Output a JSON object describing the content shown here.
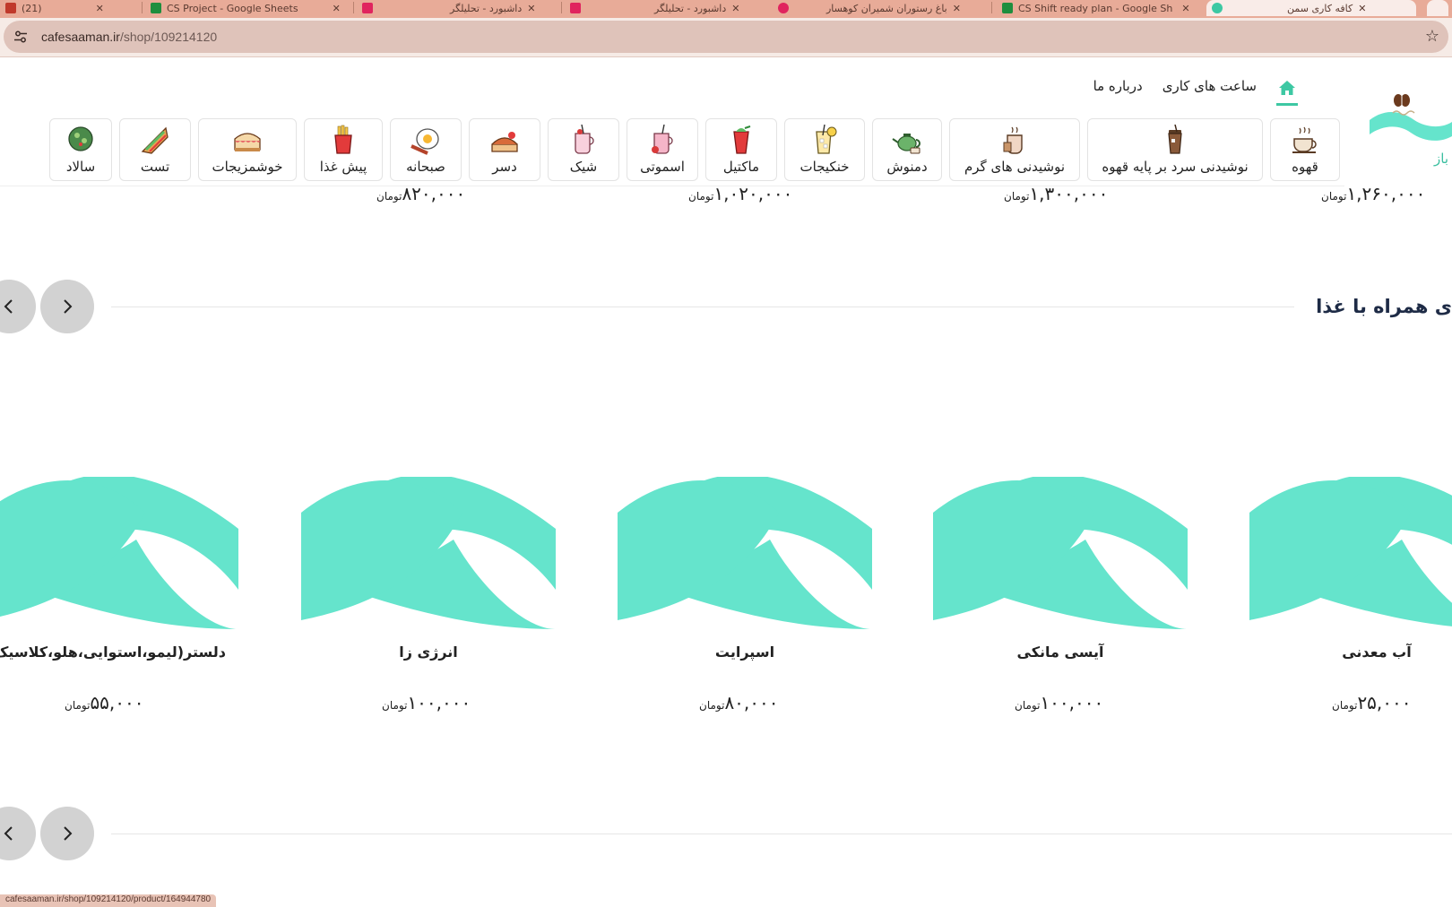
{
  "browser": {
    "tabs": [
      {
        "label": "(21)",
        "favicon_color": "#c0392b"
      },
      {
        "label": "CS Project - Google Sheets",
        "favicon_color": "#1e8e3e"
      },
      {
        "label": "داشبورد - تحلیلگر",
        "favicon_color": "#e0245e"
      },
      {
        "label": "داشبورد - تحلیلگر",
        "favicon_color": "#e0245e"
      },
      {
        "label": "باغ رستوران شمیران کوهسار",
        "favicon_color": "#e0245e"
      },
      {
        "label": "CS Shift ready plan - Google Sh",
        "favicon_color": "#1e8e3e"
      },
      {
        "label": "کافه کاری سمن",
        "favicon_color": "#3dc8a3"
      }
    ],
    "url_host": "cafesaaman.ir",
    "url_path": "/shop/109214120",
    "status_url": "cafesaaman.ir/shop/109214120/product/164944780"
  },
  "header": {
    "logo_badge": "باز",
    "nav": [
      {
        "label": "ساعت های کاری"
      },
      {
        "label": "درباره ما"
      }
    ]
  },
  "categories": [
    {
      "label": "قهوه",
      "icon": "coffee-cup-icon"
    },
    {
      "label": "نوشیدنی سرد بر پایه قهوه",
      "icon": "iced-coffee-icon"
    },
    {
      "label": "نوشیدنی های گرم",
      "icon": "hot-drink-icon"
    },
    {
      "label": "دمنوش",
      "icon": "teapot-icon"
    },
    {
      "label": "خنکیجات",
      "icon": "lemonade-icon"
    },
    {
      "label": "ماکتیل",
      "icon": "mocktail-icon"
    },
    {
      "label": "اسموتی",
      "icon": "smoothie-icon"
    },
    {
      "label": "شیک",
      "icon": "shake-icon"
    },
    {
      "label": "دسر",
      "icon": "dessert-icon"
    },
    {
      "label": "صبحانه",
      "icon": "breakfast-icon"
    },
    {
      "label": "پیش غذا",
      "icon": "fries-icon"
    },
    {
      "label": "خوشمزیجات",
      "icon": "cake-icon"
    },
    {
      "label": "تست",
      "icon": "toast-icon"
    },
    {
      "label": "سالاد",
      "icon": "salad-icon"
    }
  ],
  "previous_prices": [
    {
      "amount": "۱,۲۶۰,۰۰۰",
      "currency": "تومان"
    },
    {
      "amount": "۱,۳۰۰,۰۰۰",
      "currency": "تومان"
    },
    {
      "amount": "۱,۰۲۰,۰۰۰",
      "currency": "تومان"
    },
    {
      "amount": "۸۲۰,۰۰۰",
      "currency": "تومان"
    }
  ],
  "section": {
    "title": "ی همراه با غذا",
    "products": [
      {
        "name": "آب معدنی",
        "price": "۲۵,۰۰۰",
        "currency": "تومان"
      },
      {
        "name": "آیسی مانکی",
        "price": "۱۰۰,۰۰۰",
        "currency": "تومان"
      },
      {
        "name": "اسپرایت",
        "price": "۸۰,۰۰۰",
        "currency": "تومان"
      },
      {
        "name": "انرژی زا",
        "price": "۱۰۰,۰۰۰",
        "currency": "تومان"
      },
      {
        "name": "دلستر(لیمو،استوایی،هلو،کلاسیک)",
        "price": "۵۵,۰۰۰",
        "currency": "تومان"
      }
    ]
  },
  "colors": {
    "brand_teal": "#65e4cc",
    "accent": "#3dc8a3",
    "title_navy": "#1e2b46"
  }
}
